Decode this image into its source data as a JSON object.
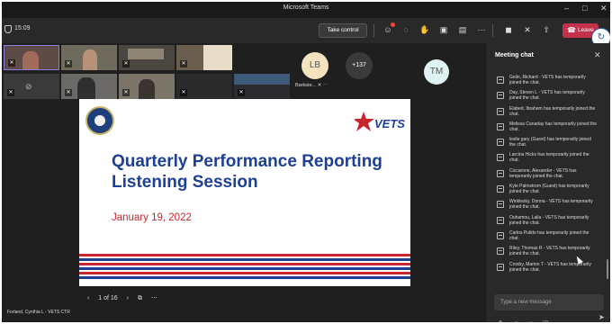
{
  "window": {
    "title": "Microsoft Teams"
  },
  "toolbar": {
    "timer": "15:09",
    "take_control": "Take control",
    "leave_label": "Leave"
  },
  "participants": {
    "lb_initials": "LB",
    "overflow_count": "+137",
    "lb_name": "Barkste...",
    "tm_initials": "TM"
  },
  "slide": {
    "title": "Quarterly Performance Reporting Listening Session",
    "date": "January 19, 2022",
    "logo_text": "VETS",
    "pager": "1 of 16"
  },
  "presenter": "Forland, Cynthia L - VETS CTR",
  "chat": {
    "title": "Meeting chat",
    "compose_placeholder": "Type a new message",
    "messages": [
      "Gelin, Richard - VETS has temporarily joined the chat.",
      "Day, Steven L - VETS has temporarily joined the chat.",
      "Elabed, Ibrahem has temporarily joined the chat.",
      "Melissa Canaday has temporarily joined the chat.",
      "leslie gary (Guest) has temporarily joined the chat.",
      "Larcina Hicks has temporarily joined the chat.",
      "Ciccarone, Alexander - VETS has temporarily joined the chat.",
      "Kyle Palmstrom (Guest) has temporarily joined the chat.",
      "Winklesky, Donna - VETS has temporarily joined the chat.",
      "Ouhamou, Laila - VETS has temporarily joined the chat.",
      "Carlos Pulido has temporarily joined the chat.",
      "Riley, Thomas R - VETS has temporarily joined the chat.",
      "Crosby, Marion T - VETS has temporarily joined the chat."
    ]
  },
  "colors": {
    "accent": "#c4314b",
    "slide_blue": "#1d3f94",
    "slide_red": "#c8262e"
  }
}
